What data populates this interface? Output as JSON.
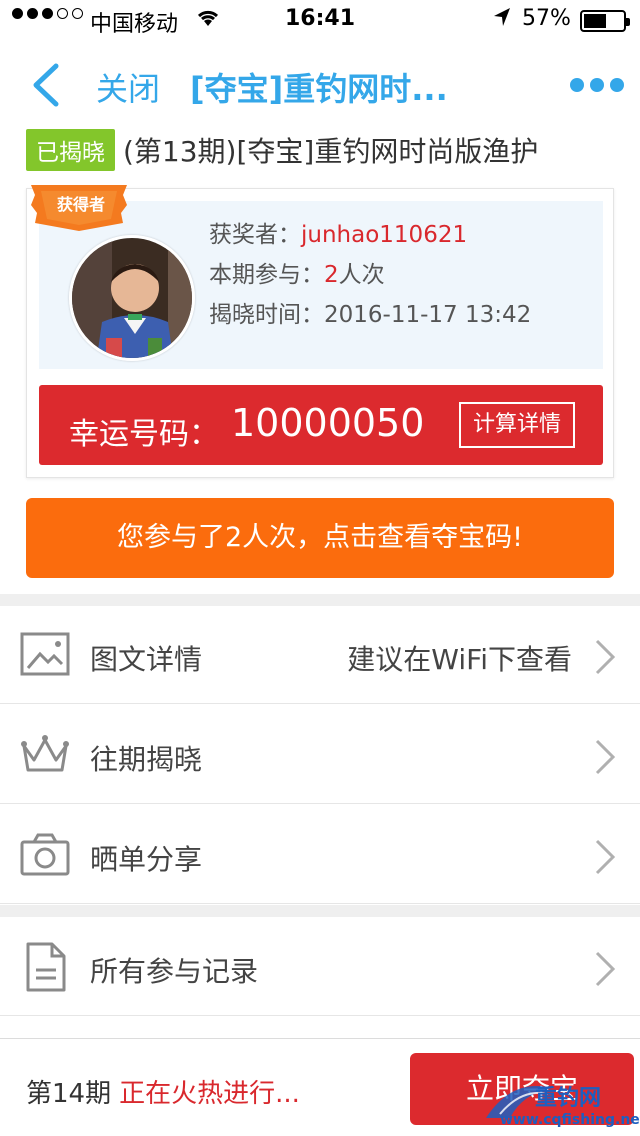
{
  "status_bar": {
    "carrier": "中国移动",
    "time": "16:41",
    "battery_percent": "57%",
    "battery_level": 0.57,
    "signal_bars": 3
  },
  "nav": {
    "close_label": "关闭",
    "title": "[夺宝]重钓网时...",
    "accent_color": "#34a7e9"
  },
  "product": {
    "badge": "已揭晓",
    "title": "(第13期)[夺宝]重钓网时尚版渔护"
  },
  "winner": {
    "ribbon_label": "获得者",
    "winner_label": "获奖者：",
    "winner_name": "junhao110621",
    "participate_label": "本期参与：",
    "participate_count": "2",
    "participate_unit": "人次",
    "reveal_label": "揭晓时间：",
    "reveal_time": "2016-11-17 13:42",
    "lucky_label": "幸运号码：",
    "lucky_number": "10000050",
    "calc_label": "计算详情"
  },
  "participation_button": "您参与了2人次，点击查看夺宝码!",
  "list": {
    "image_detail": {
      "label": "图文详情",
      "hint": "建议在WiFi下查看",
      "icon": "image-icon"
    },
    "past_reveals": {
      "label": "往期揭晓",
      "icon": "crown-icon"
    },
    "share_orders": {
      "label": "晒单分享",
      "icon": "camera-icon"
    },
    "all_records": {
      "label": "所有参与记录",
      "icon": "document-icon"
    }
  },
  "bottom": {
    "period": "第14期",
    "status": "正在火热进行...",
    "buy_label": "立即夺宝"
  },
  "watermark": {
    "text": "重钓网",
    "url": "www.cqfishing.net"
  },
  "colors": {
    "red": "#dc2a2e",
    "orange": "#fb6c0d",
    "green": "#83c62b"
  }
}
